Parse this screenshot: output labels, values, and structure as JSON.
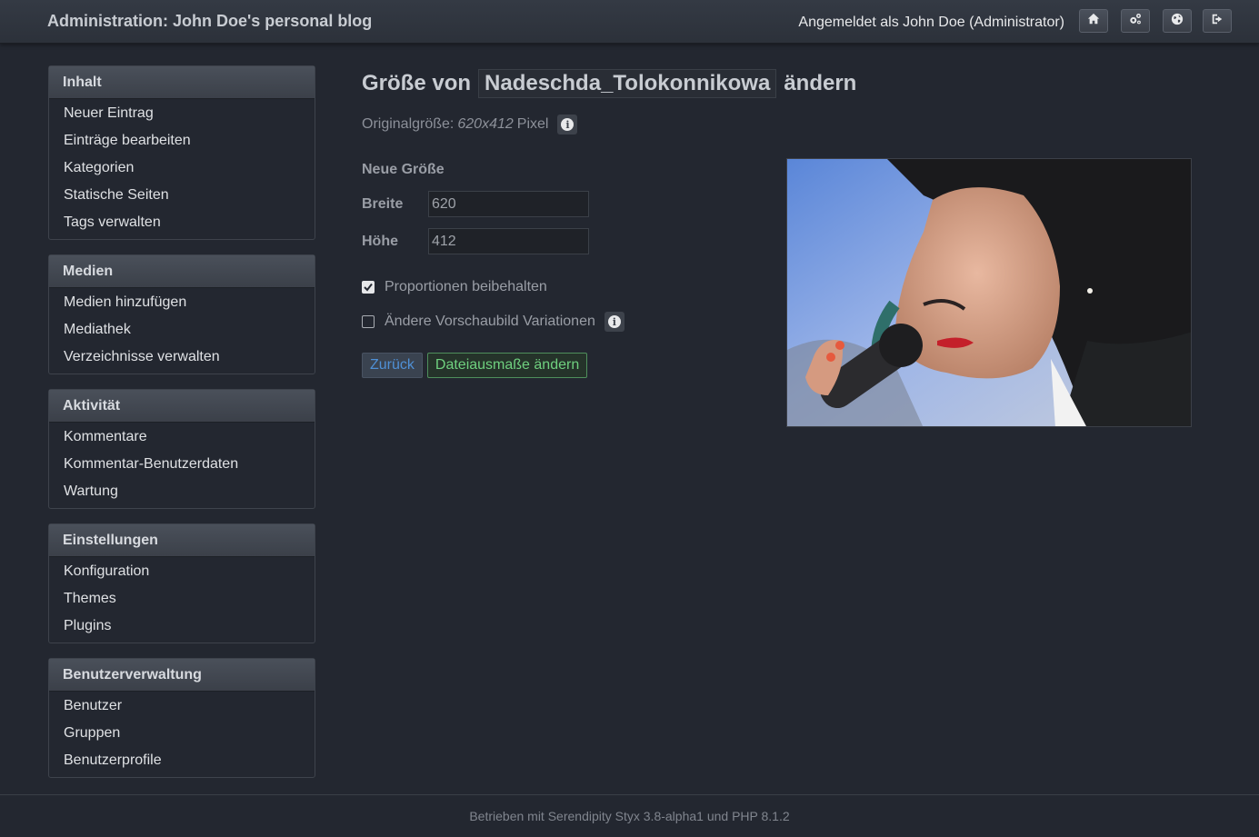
{
  "header": {
    "title": "Administration: John Doe's personal blog",
    "user_info": "Angemeldet als John Doe (Administrator)",
    "icons": [
      "home-icon",
      "dashboard-cog-icon",
      "globe-icon",
      "logout-icon"
    ]
  },
  "sidebar": {
    "sections": [
      {
        "title": "Inhalt",
        "items": [
          "Neuer Eintrag",
          "Einträge bearbeiten",
          "Kategorien",
          "Statische Seiten",
          "Tags verwalten"
        ]
      },
      {
        "title": "Medien",
        "items": [
          "Medien hinzufügen",
          "Mediathek",
          "Verzeichnisse verwalten"
        ]
      },
      {
        "title": "Aktivität",
        "items": [
          "Kommentare",
          "Kommentar-Benutzerdaten",
          "Wartung"
        ]
      },
      {
        "title": "Einstellungen",
        "items": [
          "Konfiguration",
          "Themes",
          "Plugins"
        ]
      },
      {
        "title": "Benutzerverwaltung",
        "items": [
          "Benutzer",
          "Gruppen",
          "Benutzerprofile"
        ]
      }
    ]
  },
  "main": {
    "title_prefix": "Größe von",
    "filename": "Nadeschda_Tolokonnikowa",
    "title_suffix": "ändern",
    "orig_label": "Originalgröße:",
    "orig_dims": "620x412",
    "orig_unit": "Pixel",
    "new_size_label": "Neue Größe",
    "width_label": "Breite",
    "width_value": "620",
    "height_label": "Höhe",
    "height_value": "412",
    "keep_proportions_label": "Proportionen beibehalten",
    "keep_proportions_checked": true,
    "other_variations_label": "Ändere Vorschaubild Variationen",
    "other_variations_checked": false,
    "back_button": "Zurück",
    "submit_button": "Dateiausmaße ändern"
  },
  "footer": {
    "text": "Betrieben mit Serendipity Styx 3.8-alpha1 und PHP 8.1.2"
  },
  "colors": {
    "background": "#232730",
    "panel_header": "#3b4049",
    "link_blue": "#4f90d6",
    "submit_green": "#6fd07f"
  }
}
